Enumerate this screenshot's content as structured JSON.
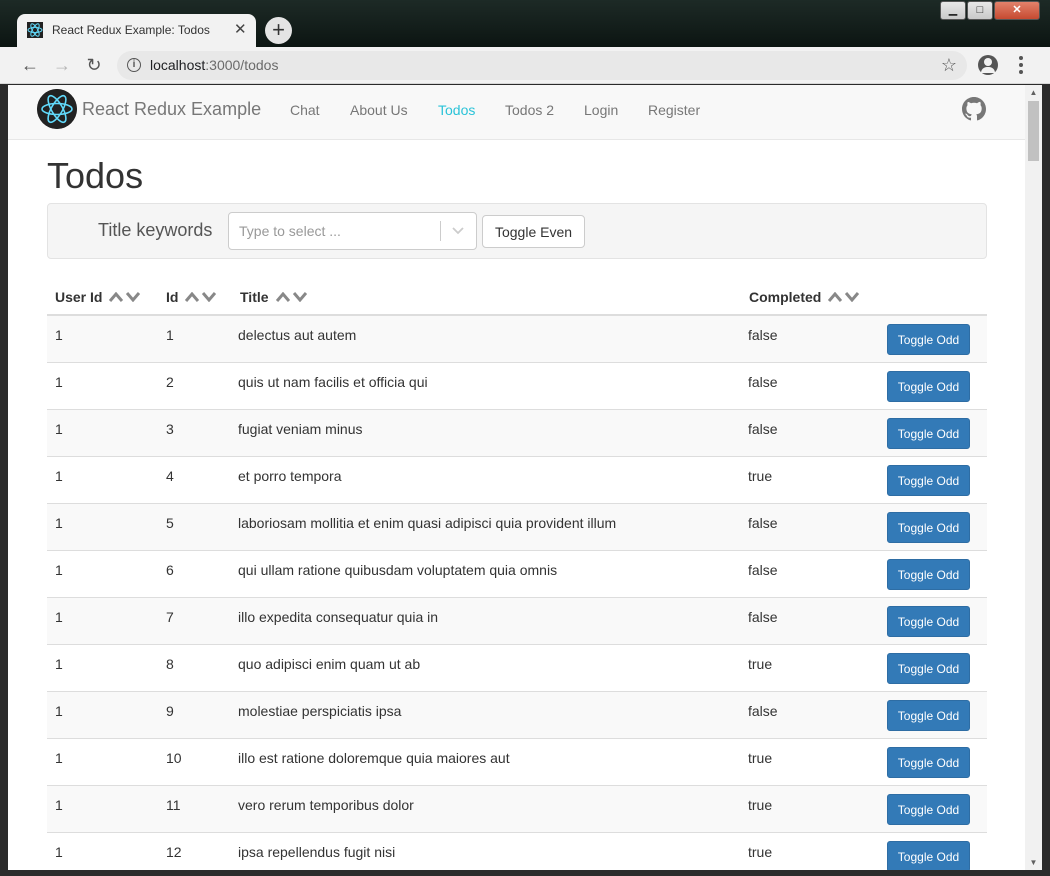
{
  "browser": {
    "tab_title": "React Redux Example: Todos",
    "tab_close": "✕",
    "new_tab": "+",
    "url_host": "localhost",
    "url_path": ":3000/todos"
  },
  "navbar": {
    "brand": "React Redux Example",
    "links": [
      "Chat",
      "About Us",
      "Todos",
      "Todos 2",
      "Login",
      "Register"
    ],
    "active": "Todos"
  },
  "page": {
    "title": "Todos",
    "filter_label": "Title keywords",
    "select_placeholder": "Type to select ...",
    "toggle_even": "Toggle Even"
  },
  "table": {
    "headers": [
      "User Id",
      "Id",
      "Title",
      "Completed"
    ],
    "row_button": "Toggle Odd",
    "rows": [
      {
        "user_id": "1",
        "id": "1",
        "title": "delectus aut autem",
        "completed": "false"
      },
      {
        "user_id": "1",
        "id": "2",
        "title": "quis ut nam facilis et officia qui",
        "completed": "false"
      },
      {
        "user_id": "1",
        "id": "3",
        "title": "fugiat veniam minus",
        "completed": "false"
      },
      {
        "user_id": "1",
        "id": "4",
        "title": "et porro tempora",
        "completed": "true"
      },
      {
        "user_id": "1",
        "id": "5",
        "title": "laboriosam mollitia et enim quasi adipisci quia provident illum",
        "completed": "false"
      },
      {
        "user_id": "1",
        "id": "6",
        "title": "qui ullam ratione quibusdam voluptatem quia omnis",
        "completed": "false"
      },
      {
        "user_id": "1",
        "id": "7",
        "title": "illo expedita consequatur quia in",
        "completed": "false"
      },
      {
        "user_id": "1",
        "id": "8",
        "title": "quo adipisci enim quam ut ab",
        "completed": "true"
      },
      {
        "user_id": "1",
        "id": "9",
        "title": "molestiae perspiciatis ipsa",
        "completed": "false"
      },
      {
        "user_id": "1",
        "id": "10",
        "title": "illo est ratione doloremque quia maiores aut",
        "completed": "true"
      },
      {
        "user_id": "1",
        "id": "11",
        "title": "vero rerum temporibus dolor",
        "completed": "true"
      },
      {
        "user_id": "1",
        "id": "12",
        "title": "ipsa repellendus fugit nisi",
        "completed": "true"
      }
    ]
  },
  "colors": {
    "active_link": "#2bc3d8",
    "button_primary": "#337ab7"
  },
  "icons": [
    "react-logo-icon",
    "github-icon",
    "back-icon",
    "forward-icon",
    "reload-icon",
    "info-icon",
    "star-icon",
    "account-icon",
    "menu-icon",
    "sort-up-icon",
    "sort-down-icon",
    "chevron-down-icon"
  ]
}
